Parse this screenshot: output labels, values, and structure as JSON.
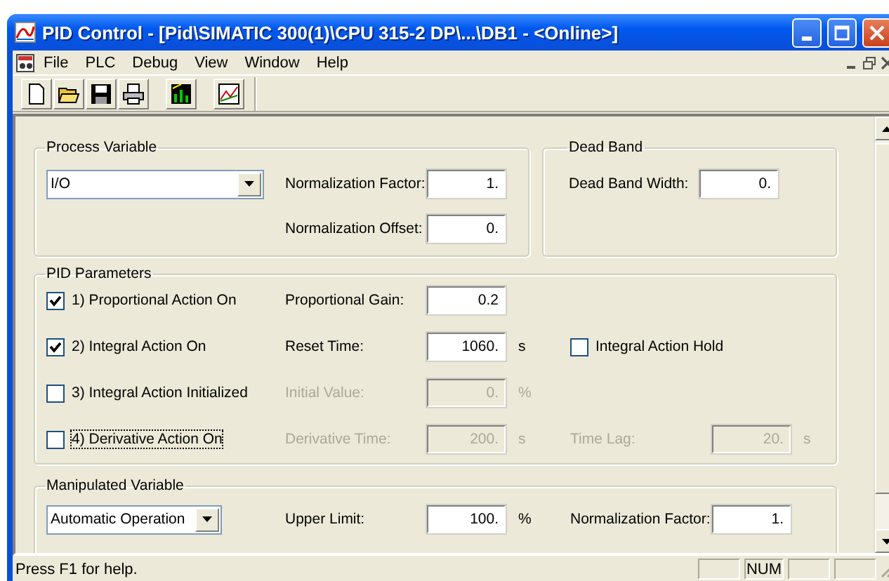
{
  "window": {
    "title": "PID Control - [Pid\\SIMATIC 300(1)\\CPU 315-2 DP\\...\\DB1 - <Online>]"
  },
  "menu": [
    "File",
    "PLC",
    "Debug",
    "View",
    "Window",
    "Help"
  ],
  "process_variable": {
    "title": "Process Variable",
    "source": "I/O",
    "fields": [
      {
        "label": "Normalization Factor:",
        "value": "1."
      },
      {
        "label": "Normalization Offset:",
        "value": "0."
      }
    ]
  },
  "dead_band": {
    "title": "Dead Band",
    "fields": [
      {
        "label": "Dead Band Width:",
        "value": "0."
      }
    ]
  },
  "pid_parameters": {
    "title": "PID Parameters",
    "rows": [
      {
        "label": "1) Proportional Action On",
        "checked": true,
        "focused": false,
        "field": {
          "label": "Proportional Gain:",
          "value": "0.2",
          "disabled": false
        }
      },
      {
        "label": "2) Integral Action On",
        "checked": true,
        "focused": false,
        "field": {
          "label": "Reset Time:",
          "value": "1060.",
          "unit": "s",
          "disabled": false
        },
        "extra": {
          "kind": "checkbox",
          "label": "Integral Action Hold",
          "checked": false
        }
      },
      {
        "label": "3) Integral Action Initialized",
        "checked": false,
        "focused": false,
        "field": {
          "label": "Initial Value:",
          "value": "0.",
          "unit": "%",
          "disabled": true
        }
      },
      {
        "label": "4) Derivative Action On",
        "checked": false,
        "focused": true,
        "field": {
          "label": "Derivative Time:",
          "value": "200.",
          "unit": "s",
          "disabled": true
        },
        "extra": {
          "kind": "field",
          "label": "Time Lag:",
          "value": "20.",
          "unit": "s",
          "disabled": true
        }
      }
    ]
  },
  "manipulated_variable": {
    "title": "Manipulated Variable",
    "mode": "Automatic Operation",
    "fields": [
      {
        "label": "Upper Limit:",
        "value": "100.",
        "unit": "%"
      },
      {
        "label": "Normalization Factor:",
        "value": "1."
      }
    ]
  },
  "status_bar": {
    "text": "Press F1 for help.",
    "indicators": [
      "NUM"
    ]
  }
}
